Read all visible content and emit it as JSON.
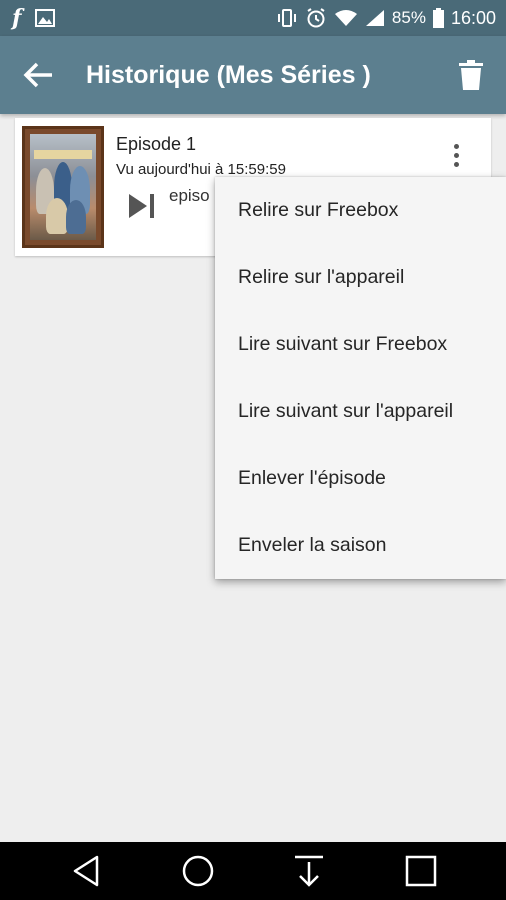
{
  "status_bar": {
    "battery": "85%",
    "time": "16:00",
    "icons": [
      "f-app-icon",
      "image-icon",
      "vibrate-icon",
      "alarm-icon",
      "wifi-icon",
      "signal-icon",
      "battery-icon"
    ]
  },
  "app_bar": {
    "title": "Historique (Mes Séries )",
    "back_icon": "arrow-back-icon",
    "delete_icon": "trash-icon"
  },
  "episode": {
    "title": "Episode 1",
    "seen": "Vu aujourd'hui à 15:59:59",
    "name": "episo"
  },
  "menu": {
    "items": [
      {
        "label": "Relire sur Freebox"
      },
      {
        "label": "Relire sur l'appareil"
      },
      {
        "label": "Lire suivant sur Freebox"
      },
      {
        "label": "Lire suivant sur l'appareil"
      },
      {
        "label": "Enlever l'épisode"
      },
      {
        "label": "Enveler la saison"
      }
    ]
  },
  "nav_bar": {
    "icons": [
      "back-triangle-icon",
      "home-circle-icon",
      "download-icon",
      "recents-square-icon"
    ]
  },
  "colors": {
    "status_bar": "#4a6a78",
    "app_bar": "#5c7f8f",
    "background": "#eeeeee",
    "menu": "#f5f5f5"
  }
}
